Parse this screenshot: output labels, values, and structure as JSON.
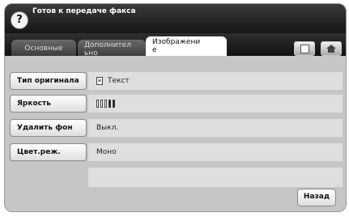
{
  "header": {
    "help_label": "?",
    "status": "Готов к передаче факса"
  },
  "tabs": [
    {
      "label": "Основные"
    },
    {
      "label": "Дополнител\nьно"
    },
    {
      "label": "Изображени\nе"
    }
  ],
  "icons": {
    "document": "document-icon",
    "home": "home-icon"
  },
  "settings": [
    {
      "button": "Тип оригинала",
      "value": "Текст",
      "icon": "document-icon"
    },
    {
      "button": "Яркость",
      "value": "",
      "level": 4,
      "level_max": 5
    },
    {
      "button": "Удалить фон",
      "value": "Выкл."
    },
    {
      "button": "Цвет.реж.",
      "value": "Моно"
    }
  ],
  "footer": {
    "back_label": "Назад"
  }
}
